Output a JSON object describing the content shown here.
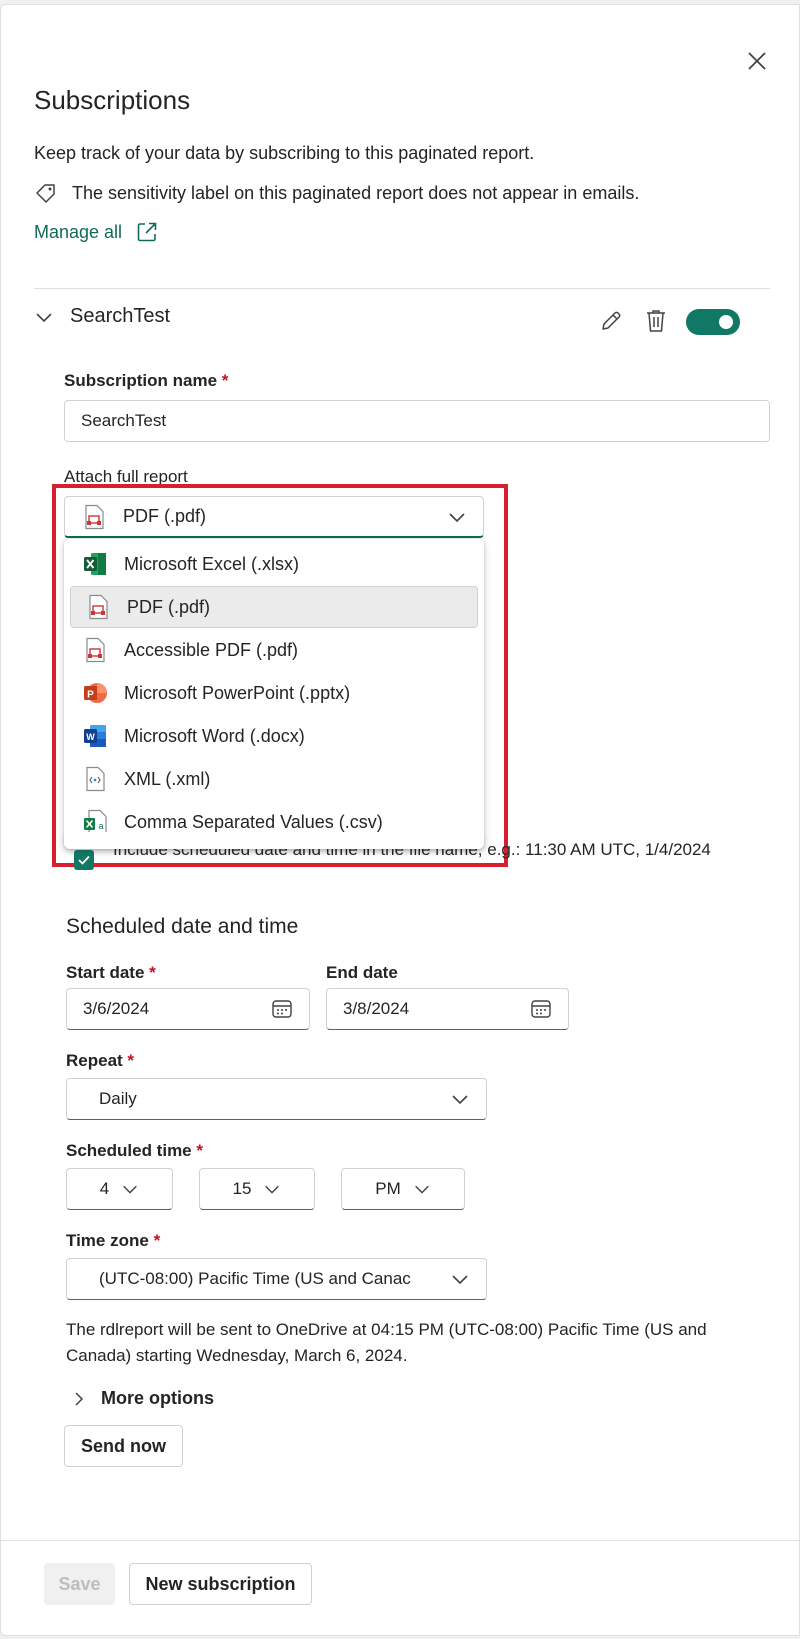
{
  "panel": {
    "title": "Subscriptions",
    "description": "Keep track of your data by subscribing to this paginated report.",
    "sensitivity_note": "The sensitivity label on this paginated report does not appear in emails.",
    "manage_all": "Manage all"
  },
  "subscription": {
    "name_header": "SearchTest",
    "enabled": true,
    "name_label": "Subscription name",
    "name_value": "SearchTest",
    "attach_label": "Attach full report",
    "attach_selected": "PDF (.pdf)",
    "attach_options": [
      {
        "label": "Microsoft Excel (.xlsx)",
        "icon": "excel-icon"
      },
      {
        "label": "PDF (.pdf)",
        "icon": "pdf-icon",
        "selected": true
      },
      {
        "label": "Accessible PDF (.pdf)",
        "icon": "pdf-icon"
      },
      {
        "label": "Microsoft PowerPoint (.pptx)",
        "icon": "powerpoint-icon"
      },
      {
        "label": "Microsoft Word (.docx)",
        "icon": "word-icon"
      },
      {
        "label": "XML (.xml)",
        "icon": "xml-icon"
      },
      {
        "label": "Comma Separated Values (.csv)",
        "icon": "csv-icon"
      }
    ],
    "include_datetime_text": "Include scheduled date and time in the file name, e.g.: 11:30 AM UTC, 1/4/2024",
    "include_datetime_checked": true
  },
  "schedule": {
    "title": "Scheduled date and time",
    "start_label": "Start date",
    "start_value": "3/6/2024",
    "end_label": "End date",
    "end_value": "3/8/2024",
    "repeat_label": "Repeat",
    "repeat_value": "Daily",
    "time_label": "Scheduled time",
    "hour": "4",
    "minute": "15",
    "ampm": "PM",
    "tz_label": "Time zone",
    "tz_value": "(UTC-08:00) Pacific Time (US and Canac",
    "summary": "The rdlreport will be sent to OneDrive at 04:15 PM (UTC-08:00) Pacific Time (US and Canada) starting Wednesday, March 6, 2024.",
    "more_options": "More options",
    "send_now": "Send now"
  },
  "footer": {
    "save": "Save",
    "new_subscription": "New subscription"
  },
  "colors": {
    "accent": "#117865",
    "link": "#0f6b57",
    "required": "#c50f1f",
    "highlight": "#d71f30"
  }
}
